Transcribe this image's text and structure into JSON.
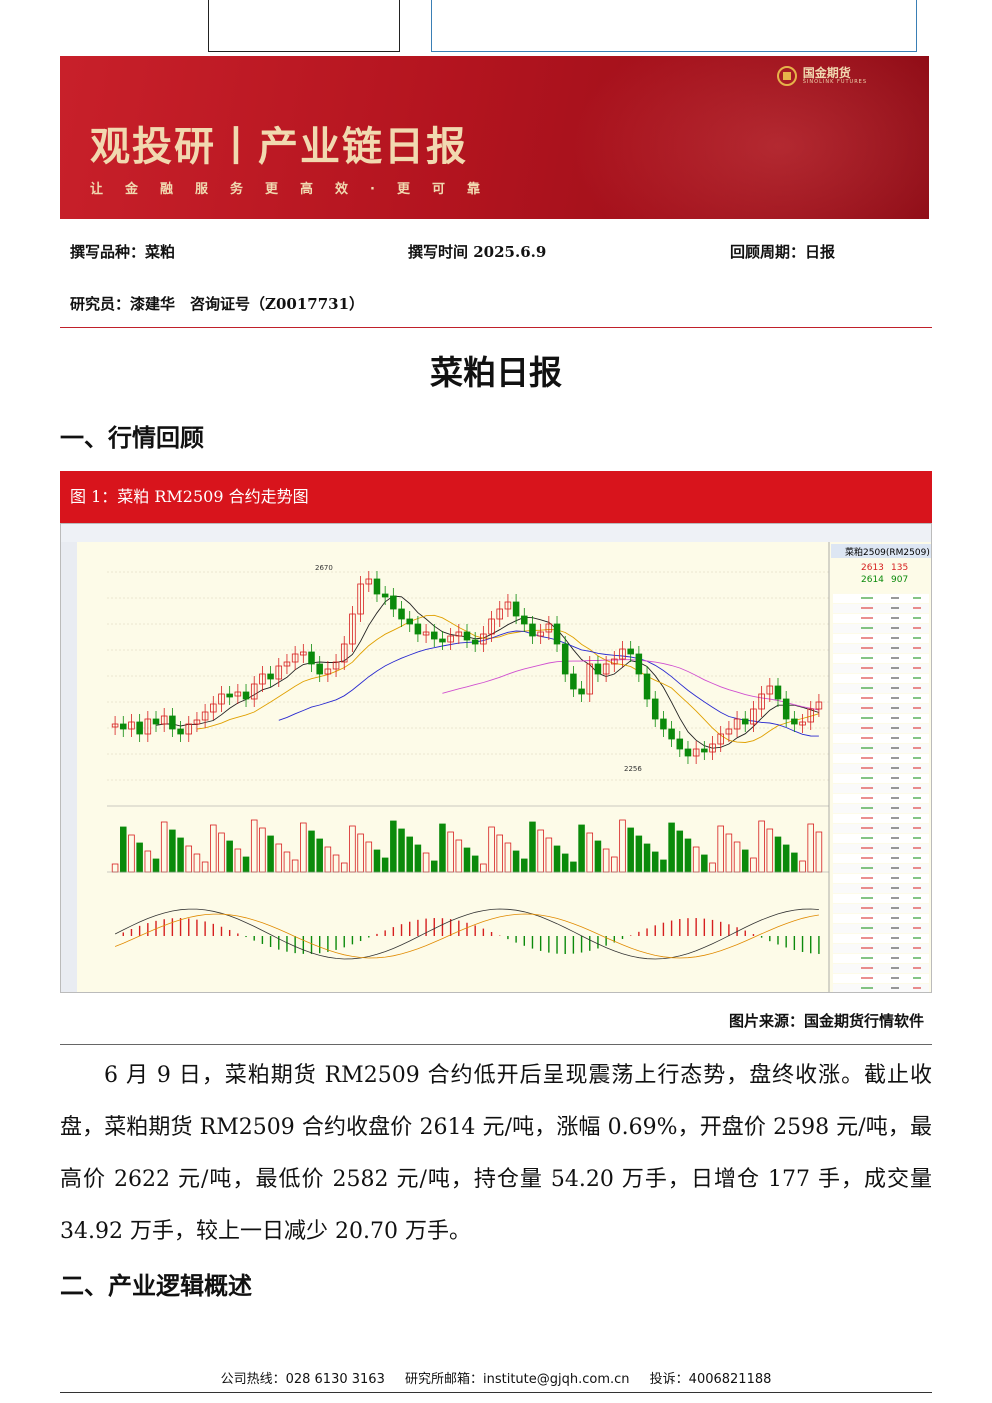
{
  "header": {
    "banner_title": "观投研丨产业链日报",
    "slogan": "让金融服务更高效·更可靠",
    "logo_name": "国金期货",
    "logo_sub": "SINOLINK FUTURES"
  },
  "meta": {
    "variety": "撰写品种：菜粕",
    "date": "撰写时间 2025.6.9",
    "period": "回顾周期：日报",
    "researcher": "研究员：漆建华　咨询证号（Z0017731）"
  },
  "doc_title": "菜粕日报",
  "section1": "一、行情回顾",
  "figure": {
    "caption": "图 1：菜粕 RM2509 合约走势图",
    "source": "图片来源：国金期货行情软件",
    "panel_title": "菜粕2509(RM2509)",
    "price_last": "2613",
    "price_change": "135",
    "price_bid": "2614",
    "price_ask": "907",
    "high_label": "2670",
    "low_label": "2256",
    "colors": {
      "up": "#d61f1f",
      "down": "#0b8a0b",
      "bg": "#fdfbe8"
    }
  },
  "chart_data": {
    "type": "candlestick",
    "title": "菜粕 RM2509 合约走势图",
    "y_annotations": {
      "high": 2670,
      "low": 2256
    },
    "last_price": 2614
  },
  "paragraph": {
    "text": "6 月 9 日，菜粕期货 RM2509 合约低开后呈现震荡上行态势，盘终收涨。截止收盘，菜粕期货 RM2509 合约收盘价 2614 元/吨，涨幅 0.69%，开盘价 2598 元/吨，最高价 2622 元/吨，最低价 2582 元/吨，持仓量 54.20 万手，日增仓 177 手，成交量 34.92 万手，较上一日减少 20.70 万手。"
  },
  "section2": "二、产业逻辑概述",
  "footer": {
    "hotline": "公司热线：028 6130 3163",
    "email": "研究所邮箱：institute@gjqh.com.cn",
    "complaint": "投诉：4006821188"
  }
}
